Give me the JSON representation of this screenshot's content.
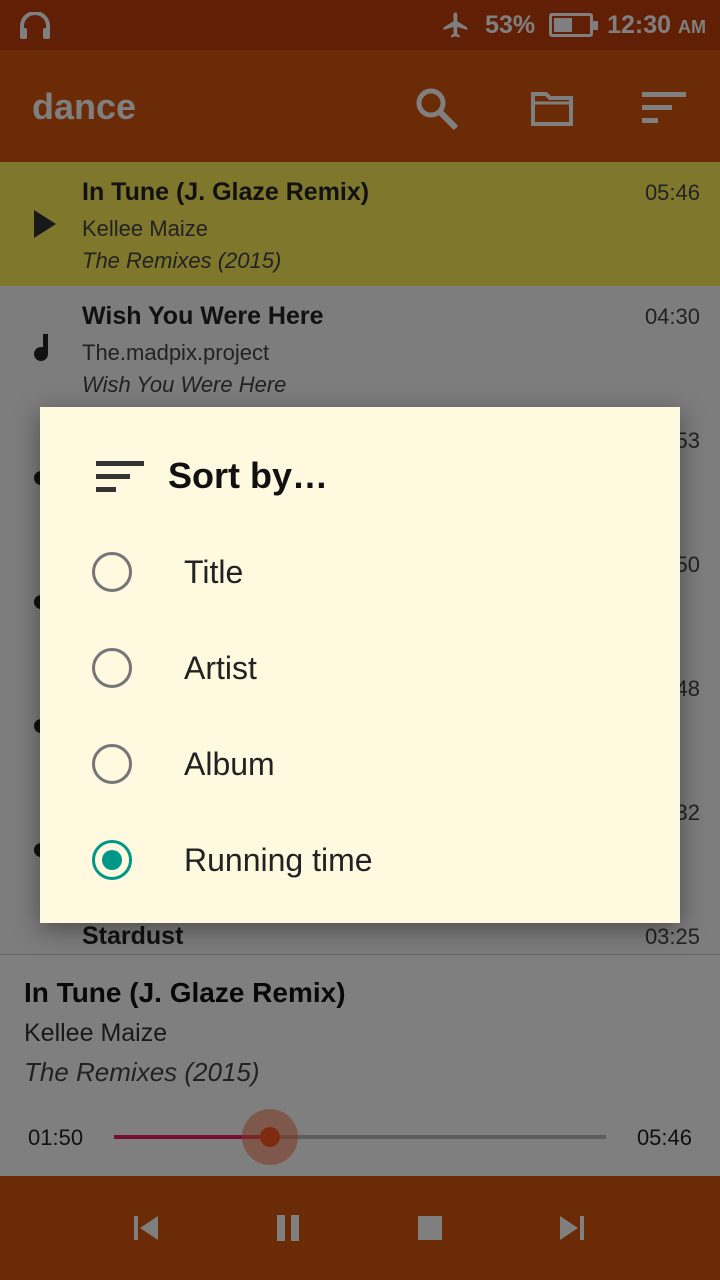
{
  "status_bar": {
    "left_icon": "headphones-icon",
    "airplane_icon": "airplane-icon",
    "battery": "53%",
    "battery_level": 0.53,
    "time": "12:30",
    "ampm": "AM"
  },
  "app_bar": {
    "title": "dance",
    "actions": [
      "search-icon",
      "folder-icon",
      "sort-icon"
    ]
  },
  "tracks": [
    {
      "title": "In Tune (J. Glaze Remix)",
      "artist": "Kellee Maize",
      "album": "The Remixes (2015)",
      "duration": "05:46",
      "icon": "play-icon",
      "active": true
    },
    {
      "title": "Wish You Were Here",
      "artist": "The.madpix.project",
      "album": "Wish You Were Here",
      "duration": "04:30",
      "icon": "music-note-icon"
    },
    {
      "title": "",
      "artist": "",
      "album": "",
      "duration": "53",
      "icon": "music-note-icon"
    },
    {
      "title": "",
      "artist": "",
      "album": "",
      "duration": "50",
      "icon": "music-note-icon"
    },
    {
      "title": "",
      "artist": "",
      "album": "",
      "duration": "48",
      "icon": "music-note-icon"
    },
    {
      "title": "",
      "artist": "",
      "album": "",
      "duration": "32",
      "icon": "music-note-icon"
    },
    {
      "title": "Stardust",
      "artist": "",
      "album": "",
      "duration": "03:25",
      "icon": "music-note-icon"
    }
  ],
  "now_playing": {
    "title": "In Tune (J. Glaze Remix)",
    "artist": "Kellee Maize",
    "album": "The Remixes (2015)",
    "elapsed": "01:50",
    "total": "05:46",
    "progress": 0.318
  },
  "controls": [
    "previous-icon",
    "pause-icon",
    "stop-icon",
    "next-icon"
  ],
  "sort_dialog": {
    "title": "Sort by…",
    "icon": "sort-icon",
    "options": [
      {
        "label": "Title",
        "selected": false
      },
      {
        "label": "Artist",
        "selected": false
      },
      {
        "label": "Album",
        "selected": false
      },
      {
        "label": "Running time",
        "selected": true
      }
    ]
  },
  "colors": {
    "status_bar": "#c2410c",
    "app_bar": "#d9570e",
    "active_row": "#ffee58",
    "dialog_bg": "#fff9e0",
    "radio_selected": "#009688",
    "seek_progress": "#e91e63"
  }
}
